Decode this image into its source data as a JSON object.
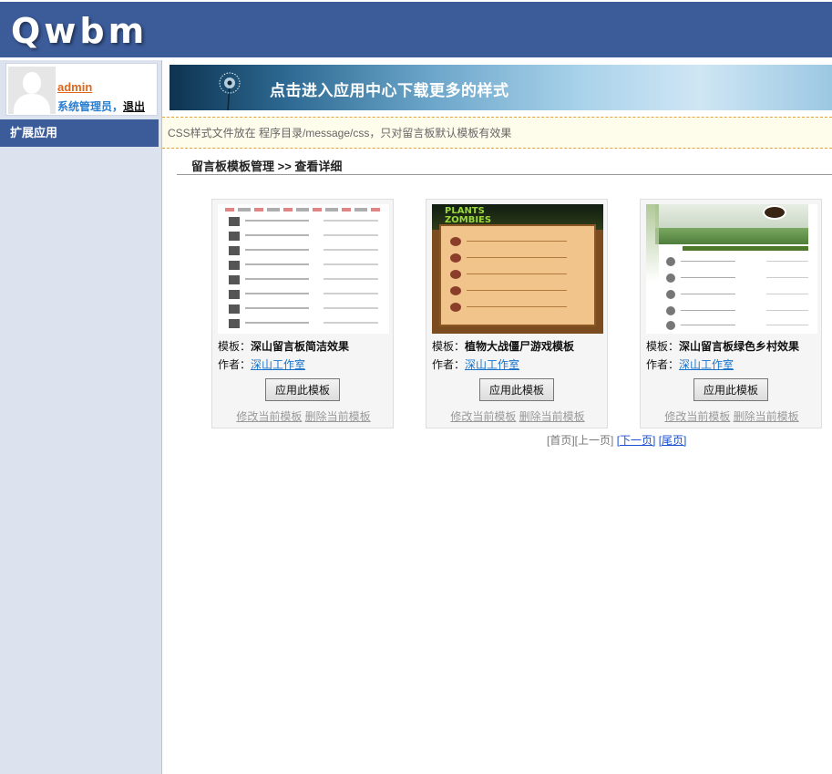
{
  "app": {
    "logo": "Qwbm"
  },
  "user": {
    "name": "admin",
    "role": "系统管理员",
    "separator": "，",
    "logout_label": "退出"
  },
  "sidebar": {
    "items": [
      {
        "label": "扩展应用"
      }
    ]
  },
  "banner": {
    "text": "点击进入应用中心下载更多的样式"
  },
  "notice": {
    "text": "CSS样式文件放在 程序目录/message/css，只对留言板默认模板有效果"
  },
  "breadcrumb": {
    "text": "留言板模板管理 >> 查看详细"
  },
  "labels": {
    "template_prefix": "模板：",
    "author_prefix": "作者：",
    "apply_button": "应用此模板",
    "edit_link": "修改当前模板",
    "delete_link": "删除当前模板"
  },
  "templates": [
    {
      "name": "深山留言板简洁效果",
      "author": "深山工作室",
      "thumb_icon": "simple-white-template-preview"
    },
    {
      "name": "植物大战僵尸游戏模板",
      "author": "深山工作室",
      "thumb_icon": "plants-vs-zombies-template-preview",
      "thumb_logo": "PLANTS ZOMBIES"
    },
    {
      "name": "深山留言板绿色乡村效果",
      "author": "深山工作室",
      "thumb_icon": "green-countryside-template-preview"
    }
  ],
  "pager": {
    "first": "[首页]",
    "prev": "[上一页]",
    "next": "[下一页]",
    "last": "[尾页]"
  },
  "colors": {
    "header": "#3b5b99",
    "sidebar": "#dde3ee",
    "username": "#e0661b",
    "role": "#2a7fd0",
    "link": "#1a73c9",
    "notice_bg": "#fefcea",
    "notice_border": "#e3a53a"
  }
}
